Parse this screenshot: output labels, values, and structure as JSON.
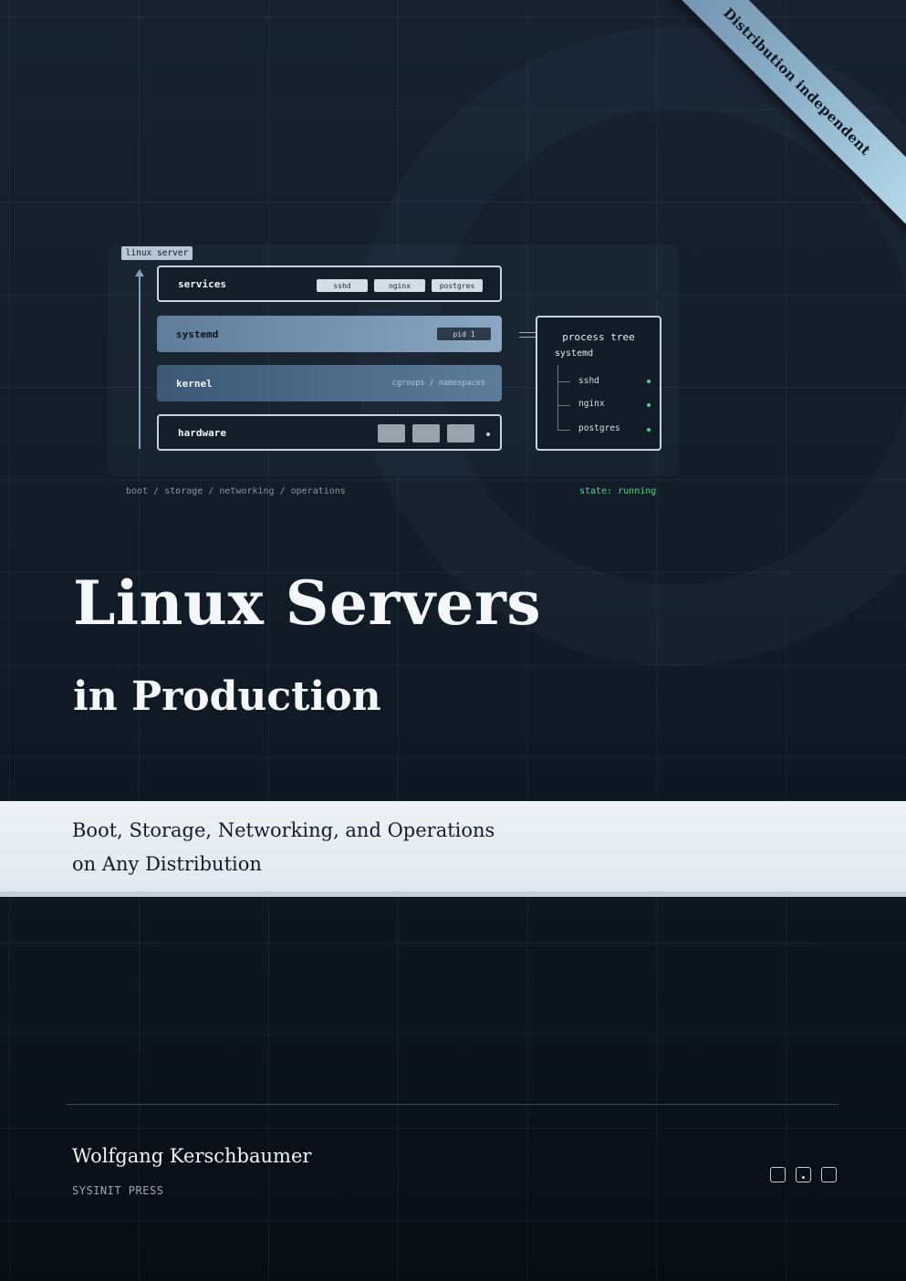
{
  "ribbon": {
    "text": "Distribution independent"
  },
  "diagram": {
    "tag": "linux server",
    "layers": {
      "services": {
        "label": "services",
        "chips": [
          "sshd",
          "nginx",
          "postgres"
        ]
      },
      "systemd": {
        "label": "systemd",
        "pid": "pid 1"
      },
      "kernel": {
        "label": "kernel",
        "note": "cgroups / namespaces"
      },
      "hardware": {
        "label": "hardware"
      }
    },
    "process_tree": {
      "title": "process tree",
      "root": "systemd",
      "items": [
        "sshd",
        "nginx",
        "postgres"
      ],
      "status_color": "#48d58a"
    },
    "caption_left": "boot / storage / networking / operations",
    "caption_right": "state: running"
  },
  "title": "Linux Servers",
  "subtitle": "in Production",
  "band": {
    "line1": "Boot, Storage, Networking, and Operations",
    "line2": "on Any Distribution"
  },
  "author": "Wolfgang Kerschbaumer",
  "publisher": "SYSINIT PRESS",
  "colors": {
    "background": "#121c27",
    "accent": "#8eb3cb",
    "status_green": "#48d58a",
    "band": "#e6ebf1"
  }
}
